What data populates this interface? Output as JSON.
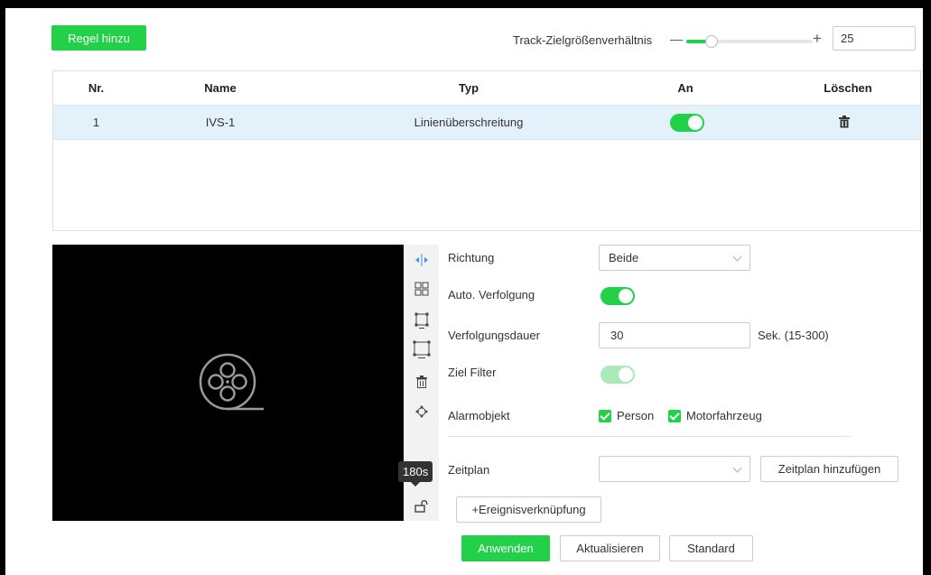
{
  "top": {
    "add_rule_label": "Regel hinzu",
    "ratio_label": "Track-Zielgrößenverhältnis",
    "minus": "—",
    "plus": "+",
    "ratio_value": "25",
    "ratio_fraction": 0.2
  },
  "table": {
    "headers": {
      "nr": "Nr.",
      "name": "Name",
      "typ": "Typ",
      "an": "An",
      "delete": "Löschen"
    },
    "rows": [
      {
        "nr": "1",
        "name": "IVS-1",
        "typ": "Linienüberschreitung",
        "on": true
      }
    ]
  },
  "tools": {
    "tooltip": "180s",
    "icons": [
      "direction-icon",
      "grid-icon",
      "min-box-icon",
      "max-box-icon",
      "trash-icon",
      "move-icon",
      "lock-icon"
    ]
  },
  "form": {
    "direction_label": "Richtung",
    "direction_value": "Beide",
    "auto_track_label": "Auto. Verfolgung",
    "track_duration_label": "Verfolgungsdauer",
    "track_duration_value": "30",
    "track_duration_unit": "Sek. (15-300)",
    "target_filter_label": "Ziel Filter",
    "alarm_object_label": "Alarmobjekt",
    "alarm_person": "Person",
    "alarm_vehicle": "Motorfahrzeug",
    "schedule_label": "Zeitplan",
    "schedule_value": "",
    "add_schedule_label": "Zeitplan hinzufügen",
    "event_link_label": "+Ereignisverknüpfung"
  },
  "actions": {
    "apply": "Anwenden",
    "refresh": "Aktualisieren",
    "default": "Standard"
  },
  "colors": {
    "accent": "#22d04a",
    "row_highlight": "#e3f1fb"
  }
}
